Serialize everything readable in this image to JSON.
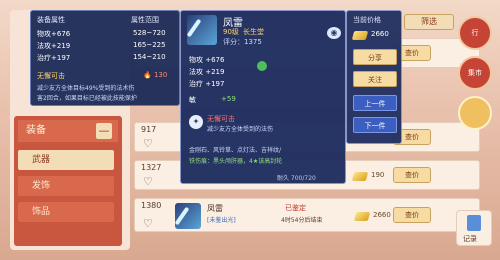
{
  "left_panel": {
    "header_col1": "装备属性",
    "header_col2": "属性范围",
    "stats": [
      {
        "label": "物攻+676",
        "range": "528~720"
      },
      {
        "label": "法攻+219",
        "range": "165~225"
      },
      {
        "label": "治疗+197",
        "range": "154~210"
      }
    ],
    "skill_name": "无懈可击",
    "skill_points": "130",
    "skill_desc": "减少友方全体目标49%受到的法术伤",
    "skill_desc2": "害2回合，如果目标已经被此技能保护"
  },
  "item": {
    "name": "凤雷",
    "level_label": "90级",
    "owner": "长生堂",
    "score_label": "评分：1375",
    "stats": [
      "物攻 +676",
      "法攻 +219",
      "治疗 +197"
    ],
    "soul_label": "敏",
    "soul_value": "+59",
    "skill_title": "无懈可击",
    "skill_desc": "减少友方全体受到的法伤",
    "extra1": "金刚石、风铃草、点灯法、吉祥纹/",
    "extra2": "铁伤痕：黑头颅肝器，4★该高封轮",
    "footer": "耐久 700/720"
  },
  "right_panel": {
    "title": "当前价格",
    "price": "2660",
    "buttons": [
      "分享",
      "关注",
      "上一件",
      "下一件"
    ]
  },
  "category": {
    "header": "装备",
    "collapse": "—",
    "items": [
      "武器",
      "发饰",
      "饰品"
    ]
  },
  "top_tab": "筛选",
  "rows": [
    {
      "num": "",
      "price": "2660",
      "buy": "查价"
    },
    {
      "num": "917",
      "price": "",
      "buy": "查价"
    },
    {
      "num": "1327",
      "price": "190",
      "buy": "查价"
    },
    {
      "num": "1380",
      "price": "2660",
      "buy": "查价"
    }
  ],
  "row4": {
    "name": "凤雷",
    "sub": "[未鉴出光]",
    "tag": "已鉴定",
    "time": "4时54分后结束"
  },
  "right_buttons": [
    "行",
    "集市",
    "",
    "记录"
  ]
}
